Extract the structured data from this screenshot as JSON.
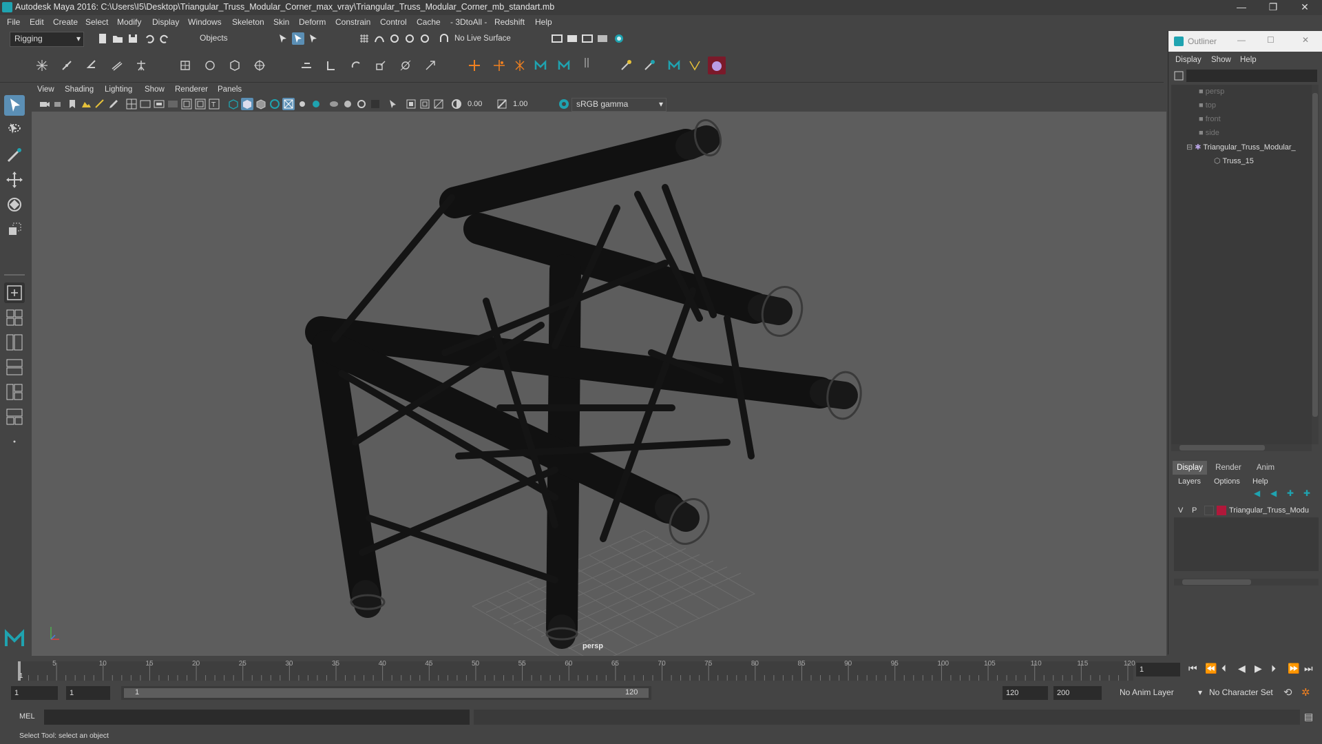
{
  "window": {
    "title": "Autodesk Maya 2016: C:\\Users\\I5\\Desktop\\Triangular_Truss_Modular_Corner_max_vray\\Triangular_Truss_Modular_Corner_mb_standart.mb",
    "minimize": "—",
    "restore": "❐",
    "close": "✕"
  },
  "menu": [
    "File",
    "Edit",
    "Create",
    "Select",
    "Modify",
    "Display",
    "Windows",
    "Skeleton",
    "Skin",
    "Deform",
    "Constrain",
    "Control",
    "Cache",
    "- 3DtoAll -",
    "Redshift",
    "Help"
  ],
  "status": {
    "mode": "Rigging",
    "selection_mask": "Objects",
    "live_surface": "No Live Surface"
  },
  "viewport": {
    "menu": [
      "View",
      "Shading",
      "Lighting",
      "Show",
      "Renderer",
      "Panels"
    ],
    "exposure": "0.00",
    "gamma": "1.00",
    "color_space": "sRGB gamma",
    "camera_label": "persp"
  },
  "outliner": {
    "title": "Outliner",
    "menu": [
      "Display",
      "Show",
      "Help"
    ],
    "items": [
      {
        "label": "persp",
        "dim": true
      },
      {
        "label": "top",
        "dim": true
      },
      {
        "label": "front",
        "dim": true
      },
      {
        "label": "side",
        "dim": true
      },
      {
        "label": "Triangular_Truss_Modular_",
        "dim": false
      },
      {
        "label": "Truss_15",
        "dim": false
      }
    ]
  },
  "layer_editor": {
    "tabs": [
      "Display",
      "Render",
      "Anim"
    ],
    "menu": [
      "Layers",
      "Options",
      "Help"
    ],
    "layer": {
      "v": "V",
      "p": "P",
      "name": "Triangular_Truss_Modu",
      "color": "#b0183a"
    }
  },
  "timeline": {
    "ticks": [
      "5",
      "10",
      "15",
      "20",
      "25",
      "30",
      "35",
      "40",
      "45",
      "50",
      "55",
      "60",
      "65",
      "70",
      "75",
      "80",
      "85",
      "90",
      "95",
      "100",
      "105",
      "110",
      "115",
      "120"
    ],
    "start_tick": "1",
    "current_frame": "1"
  },
  "range": {
    "start": "1",
    "playback_start": "1",
    "slider_start": "1",
    "slider_end": "120",
    "playback_end": "120",
    "end": "200",
    "anim_layer": "No Anim Layer",
    "character_set": "No Character Set"
  },
  "command": {
    "lang": "MEL"
  },
  "help_line": "Select Tool: select an object",
  "colors": {
    "accent": "#1fa3b0",
    "layer": "#b0183a"
  }
}
